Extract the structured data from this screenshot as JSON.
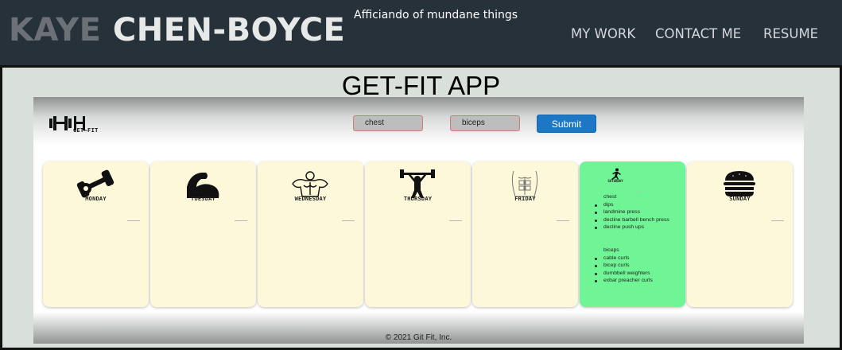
{
  "header": {
    "name_first": "KAYE",
    "name_last": "CHEN-BOYCE",
    "tagline": "Afficiando of mundane things",
    "nav": [
      "MY WORK",
      "CONTACT ME",
      "RESUME"
    ]
  },
  "project": {
    "title": "GET-FIT APP",
    "app": {
      "logo_text": "GET—FIT",
      "input1_value": "chest",
      "input2_value": "biceps",
      "submit_label": "Submit",
      "days": [
        {
          "label": "MONDAY",
          "icon": "dumbbell-icon"
        },
        {
          "label": "TUESDAY",
          "icon": "flexed-arm-icon"
        },
        {
          "label": "WEDNESDAY",
          "icon": "muscle-torso-icon"
        },
        {
          "label": "THURSDAY",
          "icon": "weightlifter-icon"
        },
        {
          "label": "FRIDAY",
          "icon": "abs-torso-icon"
        },
        {
          "label": "SATURDAY",
          "icon": "runner-icon"
        },
        {
          "label": "SUNDAY",
          "icon": "burger-icon"
        }
      ],
      "saturday": {
        "group1_name": "chest",
        "group1_items": [
          "dips",
          "landmine press",
          "decline barbell bench press",
          "decline push ups"
        ],
        "group2_name": "biceps",
        "group2_items": [
          "cable curls",
          "bicep curls",
          "dumbbell weighters",
          "exbar preacher curls"
        ]
      },
      "footer": "© 2021 Git Fit, Inc."
    }
  },
  "colors": {
    "header_bg": "#26313a",
    "page_bg": "#d9dfda",
    "card_bg": "#fdf8d9",
    "active_card_bg": "#6ff595",
    "submit_bg": "#1c78c4"
  }
}
